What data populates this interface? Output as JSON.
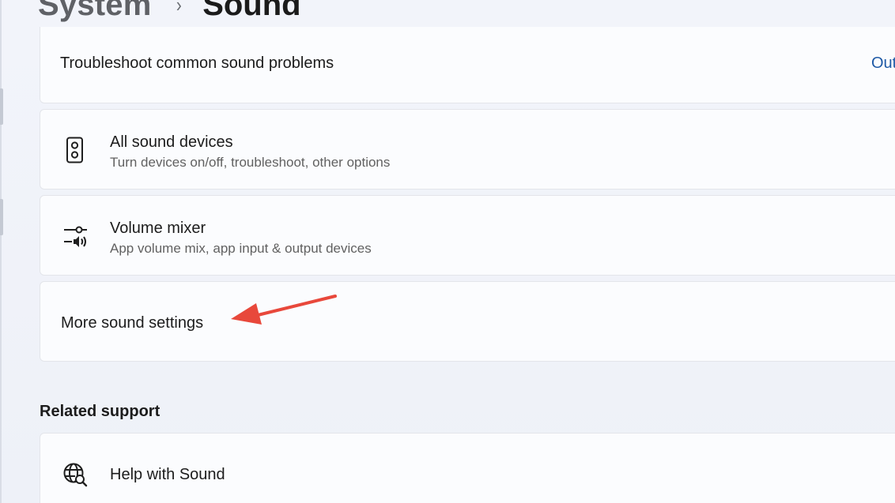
{
  "breadcrumb": {
    "parent": "System",
    "separator": "›",
    "current": "Sound"
  },
  "troubleshoot": {
    "label": "Troubleshoot common sound problems",
    "link": "Out"
  },
  "all_devices": {
    "icon": "speaker-icon",
    "title": "All sound devices",
    "subtitle": "Turn devices on/off, troubleshoot, other options"
  },
  "volume_mixer": {
    "icon": "volume-mixer-icon",
    "title": "Volume mixer",
    "subtitle": "App volume mix, app input & output devices"
  },
  "more_settings": {
    "title": "More sound settings"
  },
  "related_support": {
    "header": "Related support",
    "help": {
      "icon": "globe-search-icon",
      "title": "Help with Sound"
    }
  },
  "annotation": {
    "type": "arrow",
    "color": "#e8483b"
  }
}
